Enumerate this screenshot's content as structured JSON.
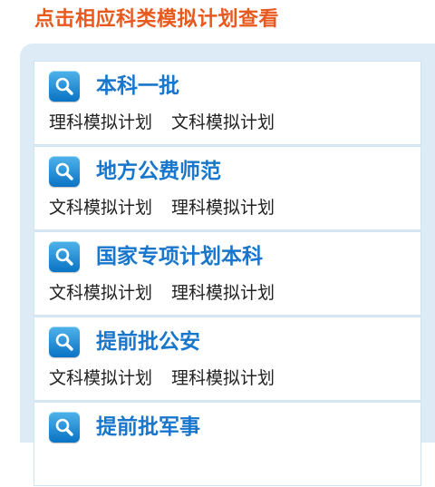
{
  "header": {
    "title": "点击相应科类模拟计划查看"
  },
  "colors": {
    "title": "#e8591e",
    "panel_bg": "#dcebf6",
    "card_title": "#1876cc",
    "icon_bg": "#0a73c4"
  },
  "cards": [
    {
      "title": "本科一批",
      "icon": "search-icon",
      "links": [
        "理科模拟计划",
        "文科模拟计划"
      ]
    },
    {
      "title": "地方公费师范",
      "icon": "search-icon",
      "links": [
        "文科模拟计划",
        "理科模拟计划"
      ]
    },
    {
      "title": "国家专项计划本科",
      "icon": "search-icon",
      "links": [
        "文科模拟计划",
        "理科模拟计划"
      ]
    },
    {
      "title": "提前批公安",
      "icon": "search-icon",
      "links": [
        "文科模拟计划",
        "理科模拟计划"
      ]
    },
    {
      "title": "提前批军事",
      "icon": "search-icon",
      "links": []
    }
  ]
}
